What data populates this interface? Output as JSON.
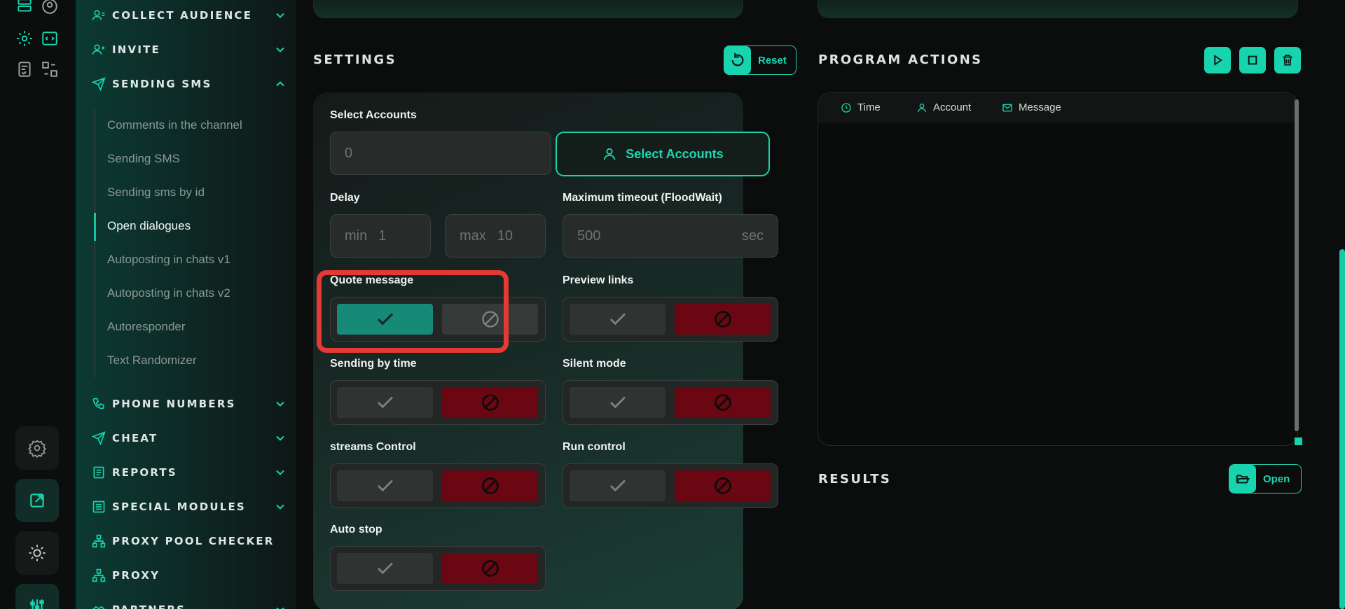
{
  "sidebar": {
    "items": [
      {
        "label": "COLLECT AUDIENCE",
        "icon": "users-icon"
      },
      {
        "label": "INVITE",
        "icon": "user-plus-icon"
      },
      {
        "label": "SENDING SMS",
        "icon": "send-icon"
      },
      {
        "label": "PHONE NUMBERS",
        "icon": "phone-icon"
      },
      {
        "label": "CHEAT",
        "icon": "send-icon"
      },
      {
        "label": "REPORTS",
        "icon": "report-icon"
      },
      {
        "label": "SPECIAL MODULES",
        "icon": "modules-icon"
      },
      {
        "label": "PROXY POOL CHECKER",
        "icon": "network-icon"
      },
      {
        "label": "PROXY",
        "icon": "network-icon"
      },
      {
        "label": "PARTNERS",
        "icon": "handshake-icon"
      }
    ],
    "sub_items": [
      "Comments in the channel",
      "Sending SMS",
      "Sending sms by id",
      "Open dialogues",
      "Autoposting in chats v1",
      "Autoposting in chats v2",
      "Autoresponder",
      "Text Randomizer"
    ],
    "active_sub": "Open dialogues"
  },
  "settings": {
    "title": "SETTINGS",
    "reset_label": "Reset",
    "select_accounts_label": "Select Accounts",
    "accounts_value": "0",
    "select_accounts_button": "Select Accounts",
    "delay_label": "Delay",
    "delay_min_prefix": "min",
    "delay_min": "1",
    "delay_max_prefix": "max",
    "delay_max": "10",
    "timeout_label": "Maximum timeout (FloodWait)",
    "timeout_value": "500",
    "timeout_unit": "sec",
    "quote_message_label": "Quote message",
    "preview_links_label": "Preview links",
    "sending_by_time_label": "Sending by time",
    "silent_mode_label": "Silent mode",
    "streams_control_label": "streams Control",
    "run_control_label": "Run control",
    "auto_stop_label": "Auto stop"
  },
  "program_actions": {
    "title": "PROGRAM ACTIONS",
    "columns": [
      "Time",
      "Account",
      "Message"
    ]
  },
  "results": {
    "title": "RESULTS",
    "open_label": "Open"
  },
  "colors": {
    "accent": "#17d4ae",
    "off_red": "#6b0713",
    "on_green": "#168a77"
  }
}
